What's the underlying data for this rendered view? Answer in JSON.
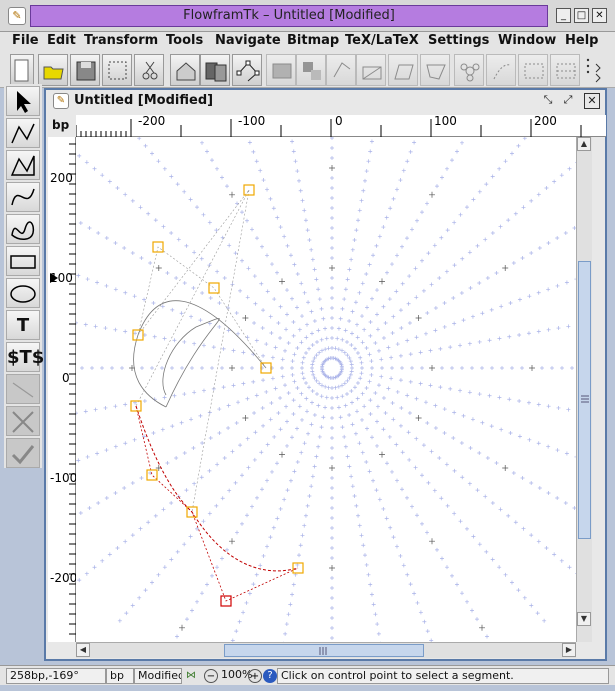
{
  "window": {
    "title": "FlowframTk – Untitled [Modified]",
    "buttons": [
      "_",
      "□",
      "✕"
    ]
  },
  "menu": [
    "File",
    "Edit",
    "Transform",
    "Tools",
    "Navigate",
    "Bitmap",
    "TeX/LaTeX",
    "Settings",
    "Window",
    "Help"
  ],
  "toolbar_icons": [
    "new-icon",
    "open-icon",
    "save-icon",
    "select-icon",
    "cut-icon",
    "home-icon",
    "copy-icon",
    "control-points-icon",
    "group-icon",
    "ungroup-icon",
    "rotate-icon",
    "scale-icon",
    "shear-icon",
    "path-icon",
    "pattern-icon",
    "star-icon",
    "spray-icon",
    "grid-icon",
    "grid-lock-icon"
  ],
  "tools": [
    "select-tool",
    "line-tool",
    "open-line-tool",
    "curve-tool",
    "closed-curve-tool",
    "rectangle-tool",
    "ellipse-tool",
    "text-tool",
    "math-tool",
    "disabled-1",
    "delete-tool",
    "finish-tool"
  ],
  "frame": {
    "title": "Untitled [Modified]",
    "unit": "bp",
    "hruler_labels": [
      "-200",
      "-100",
      "0",
      "100",
      "200"
    ],
    "vruler_labels": [
      "200",
      "100",
      "0",
      "-100",
      "-200"
    ]
  },
  "status": {
    "position": "258bp,-169°",
    "unit": "bp",
    "modified": "Modified",
    "zoom": "100%",
    "message": "Click on control point to select a segment."
  },
  "colors": {
    "accent": "#b57ce0",
    "control_point": "#f0a800",
    "selected_point": "#d00000",
    "grid": "#a9b2e8"
  }
}
